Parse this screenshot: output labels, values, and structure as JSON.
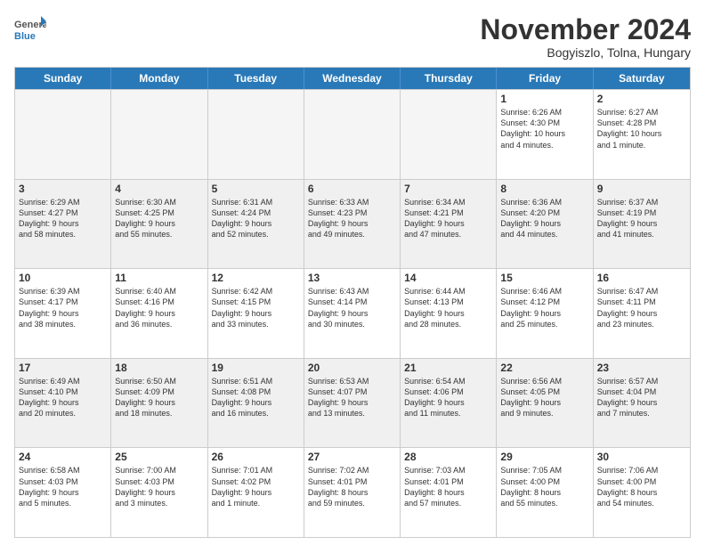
{
  "logo": {
    "general": "General",
    "blue": "Blue"
  },
  "title": "November 2024",
  "subtitle": "Bogyiszlo, Tolna, Hungary",
  "header_days": [
    "Sunday",
    "Monday",
    "Tuesday",
    "Wednesday",
    "Thursday",
    "Friday",
    "Saturday"
  ],
  "rows": [
    {
      "alt": false,
      "cells": [
        {
          "day": "",
          "empty": true,
          "lines": []
        },
        {
          "day": "",
          "empty": true,
          "lines": []
        },
        {
          "day": "",
          "empty": true,
          "lines": []
        },
        {
          "day": "",
          "empty": true,
          "lines": []
        },
        {
          "day": "",
          "empty": true,
          "lines": []
        },
        {
          "day": "1",
          "empty": false,
          "lines": [
            "Sunrise: 6:26 AM",
            "Sunset: 4:30 PM",
            "Daylight: 10 hours",
            "and 4 minutes."
          ]
        },
        {
          "day": "2",
          "empty": false,
          "lines": [
            "Sunrise: 6:27 AM",
            "Sunset: 4:28 PM",
            "Daylight: 10 hours",
            "and 1 minute."
          ]
        }
      ]
    },
    {
      "alt": true,
      "cells": [
        {
          "day": "3",
          "empty": false,
          "lines": [
            "Sunrise: 6:29 AM",
            "Sunset: 4:27 PM",
            "Daylight: 9 hours",
            "and 58 minutes."
          ]
        },
        {
          "day": "4",
          "empty": false,
          "lines": [
            "Sunrise: 6:30 AM",
            "Sunset: 4:25 PM",
            "Daylight: 9 hours",
            "and 55 minutes."
          ]
        },
        {
          "day": "5",
          "empty": false,
          "lines": [
            "Sunrise: 6:31 AM",
            "Sunset: 4:24 PM",
            "Daylight: 9 hours",
            "and 52 minutes."
          ]
        },
        {
          "day": "6",
          "empty": false,
          "lines": [
            "Sunrise: 6:33 AM",
            "Sunset: 4:23 PM",
            "Daylight: 9 hours",
            "and 49 minutes."
          ]
        },
        {
          "day": "7",
          "empty": false,
          "lines": [
            "Sunrise: 6:34 AM",
            "Sunset: 4:21 PM",
            "Daylight: 9 hours",
            "and 47 minutes."
          ]
        },
        {
          "day": "8",
          "empty": false,
          "lines": [
            "Sunrise: 6:36 AM",
            "Sunset: 4:20 PM",
            "Daylight: 9 hours",
            "and 44 minutes."
          ]
        },
        {
          "day": "9",
          "empty": false,
          "lines": [
            "Sunrise: 6:37 AM",
            "Sunset: 4:19 PM",
            "Daylight: 9 hours",
            "and 41 minutes."
          ]
        }
      ]
    },
    {
      "alt": false,
      "cells": [
        {
          "day": "10",
          "empty": false,
          "lines": [
            "Sunrise: 6:39 AM",
            "Sunset: 4:17 PM",
            "Daylight: 9 hours",
            "and 38 minutes."
          ]
        },
        {
          "day": "11",
          "empty": false,
          "lines": [
            "Sunrise: 6:40 AM",
            "Sunset: 4:16 PM",
            "Daylight: 9 hours",
            "and 36 minutes."
          ]
        },
        {
          "day": "12",
          "empty": false,
          "lines": [
            "Sunrise: 6:42 AM",
            "Sunset: 4:15 PM",
            "Daylight: 9 hours",
            "and 33 minutes."
          ]
        },
        {
          "day": "13",
          "empty": false,
          "lines": [
            "Sunrise: 6:43 AM",
            "Sunset: 4:14 PM",
            "Daylight: 9 hours",
            "and 30 minutes."
          ]
        },
        {
          "day": "14",
          "empty": false,
          "lines": [
            "Sunrise: 6:44 AM",
            "Sunset: 4:13 PM",
            "Daylight: 9 hours",
            "and 28 minutes."
          ]
        },
        {
          "day": "15",
          "empty": false,
          "lines": [
            "Sunrise: 6:46 AM",
            "Sunset: 4:12 PM",
            "Daylight: 9 hours",
            "and 25 minutes."
          ]
        },
        {
          "day": "16",
          "empty": false,
          "lines": [
            "Sunrise: 6:47 AM",
            "Sunset: 4:11 PM",
            "Daylight: 9 hours",
            "and 23 minutes."
          ]
        }
      ]
    },
    {
      "alt": true,
      "cells": [
        {
          "day": "17",
          "empty": false,
          "lines": [
            "Sunrise: 6:49 AM",
            "Sunset: 4:10 PM",
            "Daylight: 9 hours",
            "and 20 minutes."
          ]
        },
        {
          "day": "18",
          "empty": false,
          "lines": [
            "Sunrise: 6:50 AM",
            "Sunset: 4:09 PM",
            "Daylight: 9 hours",
            "and 18 minutes."
          ]
        },
        {
          "day": "19",
          "empty": false,
          "lines": [
            "Sunrise: 6:51 AM",
            "Sunset: 4:08 PM",
            "Daylight: 9 hours",
            "and 16 minutes."
          ]
        },
        {
          "day": "20",
          "empty": false,
          "lines": [
            "Sunrise: 6:53 AM",
            "Sunset: 4:07 PM",
            "Daylight: 9 hours",
            "and 13 minutes."
          ]
        },
        {
          "day": "21",
          "empty": false,
          "lines": [
            "Sunrise: 6:54 AM",
            "Sunset: 4:06 PM",
            "Daylight: 9 hours",
            "and 11 minutes."
          ]
        },
        {
          "day": "22",
          "empty": false,
          "lines": [
            "Sunrise: 6:56 AM",
            "Sunset: 4:05 PM",
            "Daylight: 9 hours",
            "and 9 minutes."
          ]
        },
        {
          "day": "23",
          "empty": false,
          "lines": [
            "Sunrise: 6:57 AM",
            "Sunset: 4:04 PM",
            "Daylight: 9 hours",
            "and 7 minutes."
          ]
        }
      ]
    },
    {
      "alt": false,
      "cells": [
        {
          "day": "24",
          "empty": false,
          "lines": [
            "Sunrise: 6:58 AM",
            "Sunset: 4:03 PM",
            "Daylight: 9 hours",
            "and 5 minutes."
          ]
        },
        {
          "day": "25",
          "empty": false,
          "lines": [
            "Sunrise: 7:00 AM",
            "Sunset: 4:03 PM",
            "Daylight: 9 hours",
            "and 3 minutes."
          ]
        },
        {
          "day": "26",
          "empty": false,
          "lines": [
            "Sunrise: 7:01 AM",
            "Sunset: 4:02 PM",
            "Daylight: 9 hours",
            "and 1 minute."
          ]
        },
        {
          "day": "27",
          "empty": false,
          "lines": [
            "Sunrise: 7:02 AM",
            "Sunset: 4:01 PM",
            "Daylight: 8 hours",
            "and 59 minutes."
          ]
        },
        {
          "day": "28",
          "empty": false,
          "lines": [
            "Sunrise: 7:03 AM",
            "Sunset: 4:01 PM",
            "Daylight: 8 hours",
            "and 57 minutes."
          ]
        },
        {
          "day": "29",
          "empty": false,
          "lines": [
            "Sunrise: 7:05 AM",
            "Sunset: 4:00 PM",
            "Daylight: 8 hours",
            "and 55 minutes."
          ]
        },
        {
          "day": "30",
          "empty": false,
          "lines": [
            "Sunrise: 7:06 AM",
            "Sunset: 4:00 PM",
            "Daylight: 8 hours",
            "and 54 minutes."
          ]
        }
      ]
    }
  ]
}
